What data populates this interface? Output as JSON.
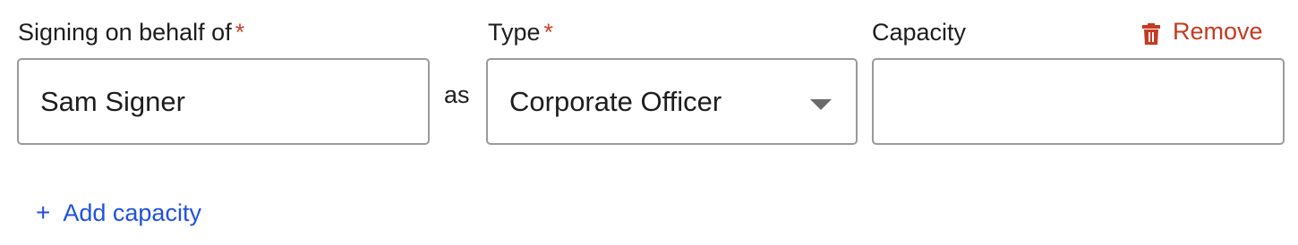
{
  "labels": {
    "signing_on_behalf_of": "Signing on behalf of",
    "type": "Type",
    "capacity": "Capacity",
    "required_marker": "*"
  },
  "fields": {
    "signer_value": "Sam Signer",
    "type_value": "Corporate Officer",
    "capacity_value": ""
  },
  "connector": "as",
  "actions": {
    "remove_label": "Remove",
    "remove_icon": "trash-icon",
    "add_label": "Add capacity",
    "add_icon": "+"
  },
  "colors": {
    "required": "#d1412b",
    "remove": "#c43a22",
    "link": "#2150e0",
    "border": "#9a9a9a"
  }
}
